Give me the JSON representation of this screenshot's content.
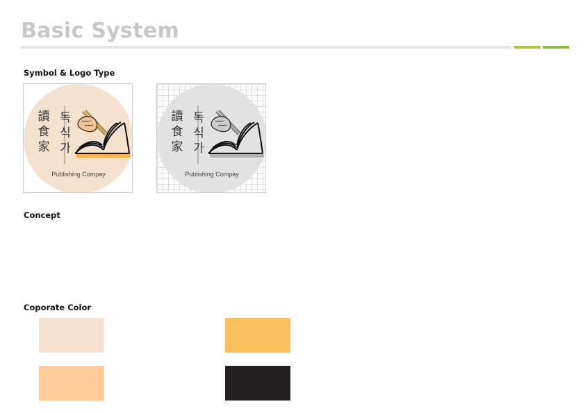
{
  "header": {
    "title": "Basic System",
    "accent_colors": [
      "#a8cc2e",
      "#8cc23a"
    ]
  },
  "sections": {
    "symbol": "Symbol & Logo Type",
    "concept": "Concept",
    "color": "Coporate Color"
  },
  "logos": [
    {
      "variant": "color",
      "circle_color": "#f4e2cf",
      "hanja": [
        "讀",
        "食",
        "家"
      ],
      "hangul": [
        "독",
        "식",
        "가"
      ],
      "subtitle": "Publishing Compay",
      "book_shadow_color": "#f9b04a",
      "dumpling_color": "#f5c38f",
      "background": "plain"
    },
    {
      "variant": "grayscale",
      "circle_color": "#e2e2e2",
      "hanja": [
        "讀",
        "食",
        "家"
      ],
      "hangul": [
        "독",
        "식",
        "가"
      ],
      "subtitle": "Publishing Compay",
      "book_shadow_color": "#b3b3b3",
      "dumpling_color": "#cccccc",
      "background": "grid"
    }
  ],
  "corporate_colors": [
    "#f5e3d0",
    "#fbc05c",
    "#fdca98",
    "#231f20"
  ]
}
